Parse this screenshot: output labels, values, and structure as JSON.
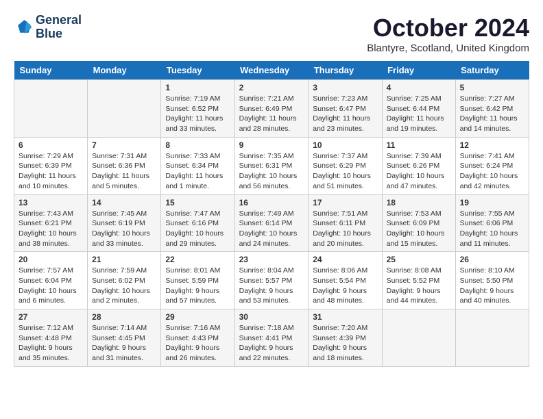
{
  "header": {
    "logo_line1": "General",
    "logo_line2": "Blue",
    "month_title": "October 2024",
    "location": "Blantyre, Scotland, United Kingdom"
  },
  "weekdays": [
    "Sunday",
    "Monday",
    "Tuesday",
    "Wednesday",
    "Thursday",
    "Friday",
    "Saturday"
  ],
  "weeks": [
    [
      {
        "day": "",
        "content": ""
      },
      {
        "day": "",
        "content": ""
      },
      {
        "day": "1",
        "content": "Sunrise: 7:19 AM\nSunset: 6:52 PM\nDaylight: 11 hours\nand 33 minutes."
      },
      {
        "day": "2",
        "content": "Sunrise: 7:21 AM\nSunset: 6:49 PM\nDaylight: 11 hours\nand 28 minutes."
      },
      {
        "day": "3",
        "content": "Sunrise: 7:23 AM\nSunset: 6:47 PM\nDaylight: 11 hours\nand 23 minutes."
      },
      {
        "day": "4",
        "content": "Sunrise: 7:25 AM\nSunset: 6:44 PM\nDaylight: 11 hours\nand 19 minutes."
      },
      {
        "day": "5",
        "content": "Sunrise: 7:27 AM\nSunset: 6:42 PM\nDaylight: 11 hours\nand 14 minutes."
      }
    ],
    [
      {
        "day": "6",
        "content": "Sunrise: 7:29 AM\nSunset: 6:39 PM\nDaylight: 11 hours\nand 10 minutes."
      },
      {
        "day": "7",
        "content": "Sunrise: 7:31 AM\nSunset: 6:36 PM\nDaylight: 11 hours\nand 5 minutes."
      },
      {
        "day": "8",
        "content": "Sunrise: 7:33 AM\nSunset: 6:34 PM\nDaylight: 11 hours\nand 1 minute."
      },
      {
        "day": "9",
        "content": "Sunrise: 7:35 AM\nSunset: 6:31 PM\nDaylight: 10 hours\nand 56 minutes."
      },
      {
        "day": "10",
        "content": "Sunrise: 7:37 AM\nSunset: 6:29 PM\nDaylight: 10 hours\nand 51 minutes."
      },
      {
        "day": "11",
        "content": "Sunrise: 7:39 AM\nSunset: 6:26 PM\nDaylight: 10 hours\nand 47 minutes."
      },
      {
        "day": "12",
        "content": "Sunrise: 7:41 AM\nSunset: 6:24 PM\nDaylight: 10 hours\nand 42 minutes."
      }
    ],
    [
      {
        "day": "13",
        "content": "Sunrise: 7:43 AM\nSunset: 6:21 PM\nDaylight: 10 hours\nand 38 minutes."
      },
      {
        "day": "14",
        "content": "Sunrise: 7:45 AM\nSunset: 6:19 PM\nDaylight: 10 hours\nand 33 minutes."
      },
      {
        "day": "15",
        "content": "Sunrise: 7:47 AM\nSunset: 6:16 PM\nDaylight: 10 hours\nand 29 minutes."
      },
      {
        "day": "16",
        "content": "Sunrise: 7:49 AM\nSunset: 6:14 PM\nDaylight: 10 hours\nand 24 minutes."
      },
      {
        "day": "17",
        "content": "Sunrise: 7:51 AM\nSunset: 6:11 PM\nDaylight: 10 hours\nand 20 minutes."
      },
      {
        "day": "18",
        "content": "Sunrise: 7:53 AM\nSunset: 6:09 PM\nDaylight: 10 hours\nand 15 minutes."
      },
      {
        "day": "19",
        "content": "Sunrise: 7:55 AM\nSunset: 6:06 PM\nDaylight: 10 hours\nand 11 minutes."
      }
    ],
    [
      {
        "day": "20",
        "content": "Sunrise: 7:57 AM\nSunset: 6:04 PM\nDaylight: 10 hours\nand 6 minutes."
      },
      {
        "day": "21",
        "content": "Sunrise: 7:59 AM\nSunset: 6:02 PM\nDaylight: 10 hours\nand 2 minutes."
      },
      {
        "day": "22",
        "content": "Sunrise: 8:01 AM\nSunset: 5:59 PM\nDaylight: 9 hours\nand 57 minutes."
      },
      {
        "day": "23",
        "content": "Sunrise: 8:04 AM\nSunset: 5:57 PM\nDaylight: 9 hours\nand 53 minutes."
      },
      {
        "day": "24",
        "content": "Sunrise: 8:06 AM\nSunset: 5:54 PM\nDaylight: 9 hours\nand 48 minutes."
      },
      {
        "day": "25",
        "content": "Sunrise: 8:08 AM\nSunset: 5:52 PM\nDaylight: 9 hours\nand 44 minutes."
      },
      {
        "day": "26",
        "content": "Sunrise: 8:10 AM\nSunset: 5:50 PM\nDaylight: 9 hours\nand 40 minutes."
      }
    ],
    [
      {
        "day": "27",
        "content": "Sunrise: 7:12 AM\nSunset: 4:48 PM\nDaylight: 9 hours\nand 35 minutes."
      },
      {
        "day": "28",
        "content": "Sunrise: 7:14 AM\nSunset: 4:45 PM\nDaylight: 9 hours\nand 31 minutes."
      },
      {
        "day": "29",
        "content": "Sunrise: 7:16 AM\nSunset: 4:43 PM\nDaylight: 9 hours\nand 26 minutes."
      },
      {
        "day": "30",
        "content": "Sunrise: 7:18 AM\nSunset: 4:41 PM\nDaylight: 9 hours\nand 22 minutes."
      },
      {
        "day": "31",
        "content": "Sunrise: 7:20 AM\nSunset: 4:39 PM\nDaylight: 9 hours\nand 18 minutes."
      },
      {
        "day": "",
        "content": ""
      },
      {
        "day": "",
        "content": ""
      }
    ]
  ]
}
